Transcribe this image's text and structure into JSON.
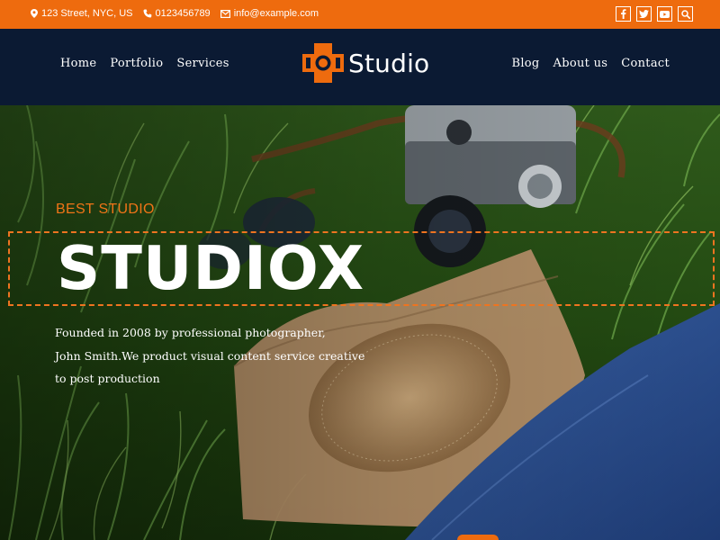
{
  "topbar": {
    "address": "123 Street, NYC, US",
    "phone": "0123456789",
    "email": "info@example.com",
    "social_icons": [
      "facebook-icon",
      "twitter-icon",
      "youtube-icon",
      "search-icon"
    ]
  },
  "nav": {
    "left": [
      "Home",
      "Portfolio",
      "Services"
    ],
    "right": [
      "Blog",
      "About us",
      "Contact"
    ],
    "brand": "Studio"
  },
  "hero": {
    "kicker": "BEST STUDIO",
    "title": "STUDIOX",
    "description": [
      "Founded in 2008 by professional photographer,",
      "John Smith.We product visual content service creative",
      "to post production"
    ]
  },
  "colors": {
    "accent": "#ee6b0e",
    "navy": "#0b1a33"
  }
}
